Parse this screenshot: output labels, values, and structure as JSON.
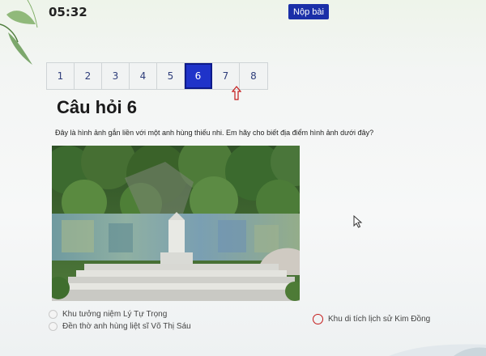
{
  "header": {
    "timer": "05:32",
    "submit_label": "Nộp bài"
  },
  "question_nav": {
    "items": [
      "1",
      "2",
      "3",
      "4",
      "5",
      "6",
      "7",
      "8"
    ],
    "active": "6"
  },
  "question": {
    "title": "Câu hỏi 6",
    "text": "Đây là hình ảnh gắn liền với một anh hùng thiếu nhi. Em hãy cho biết địa điểm hình ảnh dưới đây?"
  },
  "options": [
    {
      "label": "Khu tưởng niệm Lý Tự Trọng"
    },
    {
      "label": "Đền thờ anh hùng liệt sĩ Võ Thị Sáu"
    },
    {
      "label": "Khu di tích lịch sử Kim Đồng"
    }
  ],
  "colors": {
    "accent": "#1f33c9",
    "submit": "#1b2fa8",
    "highlight": "#c41b1b"
  },
  "icons": [
    "leaf-decoration",
    "red-arrow-pointer",
    "mouse-cursor-icon"
  ]
}
